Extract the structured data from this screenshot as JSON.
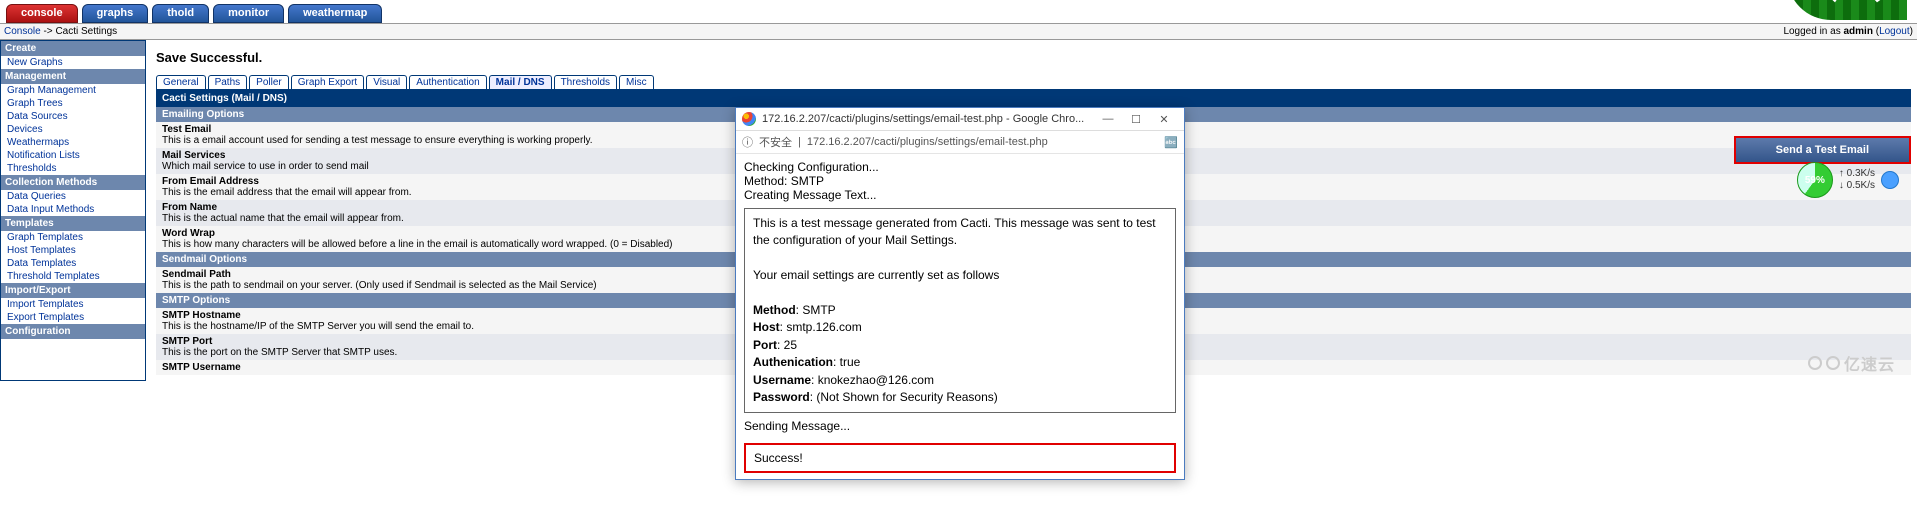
{
  "tabs": {
    "t0": "console",
    "t1": "graphs",
    "t2": "thold",
    "t3": "monitor",
    "t4": "weathermap"
  },
  "breadcrumb": {
    "console": "Console",
    "sep": " -> ",
    "page": "Cacti Settings"
  },
  "login": {
    "prefix": "Logged in as ",
    "user": "admin",
    "logout": "Logout"
  },
  "header": {
    "title": "Save Successful."
  },
  "sidebar": {
    "sec0": "Create",
    "i0": "New Graphs",
    "sec1": "Management",
    "i1": "Graph Management",
    "i2": "Graph Trees",
    "i3": "Data Sources",
    "i4": "Devices",
    "i5": "Weathermaps",
    "i6": "Notification Lists",
    "i7": "Thresholds",
    "sec2": "Collection Methods",
    "i8": "Data Queries",
    "i9": "Data Input Methods",
    "sec3": "Templates",
    "i10": "Graph Templates",
    "i11": "Host Templates",
    "i12": "Data Templates",
    "i13": "Threshold Templates",
    "sec4": "Import/Export",
    "i14": "Import Templates",
    "i15": "Export Templates",
    "sec5": "Configuration"
  },
  "subtabs": {
    "t0": "General",
    "t1": "Paths",
    "t2": "Poller",
    "t3": "Graph Export",
    "t4": "Visual",
    "t5": "Authentication",
    "t6": "Mail / DNS",
    "t7": "Thresholds",
    "t8": "Misc"
  },
  "panel": {
    "title": "Cacti Settings (Mail / DNS)"
  },
  "sections": {
    "s0": "Emailing Options",
    "s1": "Sendmail Options",
    "s2": "SMTP Options"
  },
  "opts": {
    "l0": "Test Email",
    "h0": "This is a email account used for sending a test message to ensure everything is working properly.",
    "l1": "Mail Services",
    "h1": "Which mail service to use in order to send mail",
    "l2": "From Email Address",
    "h2": "This is the email address that the email will appear from.",
    "l3": "From Name",
    "h3": "This is the actual name that the email will appear from.",
    "l4": "Word Wrap",
    "h4": "This is how many characters will be allowed before a line in the email is automatically word wrapped. (0 = Disabled)",
    "l5": "Sendmail Path",
    "h5": "This is the path to sendmail on your server. (Only used if Sendmail is selected as the Mail Service)",
    "l6": "SMTP Hostname",
    "h6": "This is the hostname/IP of the SMTP Server you will send the email to.",
    "l7": "SMTP Port",
    "h7": "This is the port on the SMTP Server that SMTP uses.",
    "l8": "SMTP Username"
  },
  "testbtn": {
    "label": "Send a Test Email"
  },
  "popup": {
    "wintitle": "172.16.2.207/cacti/plugins/settings/email-test.php - Google Chro...",
    "insecure": "不安全",
    "url": "172.16.2.207/cacti/plugins/settings/email-test.php",
    "line1": "Checking Configuration...",
    "line2": "Method: SMTP",
    "line3": "Creating Message Text...",
    "msg1": "This is a test message generated from Cacti. This message was sent to test the configuration of your Mail Settings.",
    "msg2": "Your email settings are currently set as follows",
    "method_l": "Method",
    "method_v": ": SMTP",
    "host_l": "Host",
    "host_v": ": smtp.126.com",
    "port_l": "Port",
    "port_v": ": 25",
    "auth_l": "Authenication",
    "auth_v": ": true",
    "user_l": "Username",
    "user_v": ": knokezhao@126.com",
    "pass_l": "Password",
    "pass_v": ": (Not Shown for Security Reasons)",
    "sending": "Sending Message...",
    "success": "Success!"
  },
  "speedo": {
    "pct": "59%",
    "up": "↑  0.3K/s",
    "down": "↓  0.5K/s"
  },
  "watermark": {
    "text": "亿速云"
  }
}
